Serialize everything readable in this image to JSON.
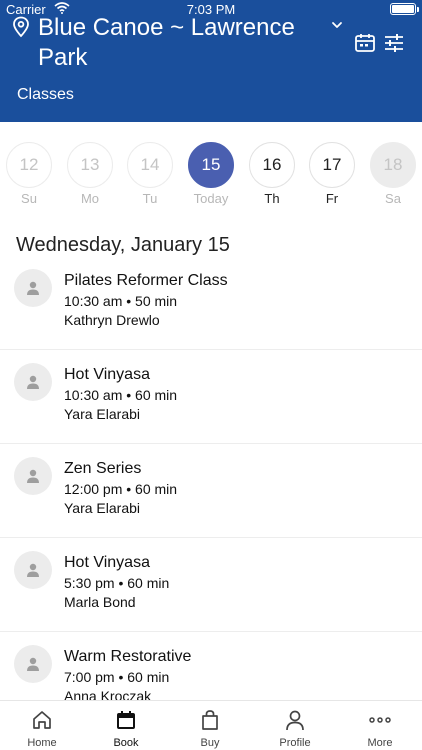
{
  "status_bar": {
    "carrier": "Carrier",
    "time": "7:03 PM"
  },
  "header": {
    "location": "Blue Canoe ~ Lawrence Park",
    "section": "Classes"
  },
  "date_strip": [
    {
      "num": "12",
      "label": "Su",
      "state": "past"
    },
    {
      "num": "13",
      "label": "Mo",
      "state": "past"
    },
    {
      "num": "14",
      "label": "Tu",
      "state": "past"
    },
    {
      "num": "15",
      "label": "Today",
      "state": "today"
    },
    {
      "num": "16",
      "label": "Th",
      "state": "future"
    },
    {
      "num": "17",
      "label": "Fr",
      "state": "future"
    },
    {
      "num": "18",
      "label": "Sa",
      "state": "disabled"
    }
  ],
  "date_heading": "Wednesday, January 15",
  "classes": [
    {
      "name": "Pilates Reformer Class",
      "time": "10:30 am • 50 min",
      "instructor": "Kathryn Drewlo"
    },
    {
      "name": "Hot Vinyasa",
      "time": "10:30 am • 60 min",
      "instructor": "Yara Elarabi"
    },
    {
      "name": "Zen Series",
      "time": "12:00 pm • 60 min",
      "instructor": "Yara Elarabi"
    },
    {
      "name": "Hot Vinyasa",
      "time": "5:30 pm • 60 min",
      "instructor": "Marla Bond"
    },
    {
      "name": "Warm Restorative",
      "time": "7:00 pm • 60 min",
      "instructor": "Anna Kroczak"
    }
  ],
  "tabs": [
    {
      "label": "Home",
      "icon": "home-icon"
    },
    {
      "label": "Book",
      "icon": "calendar-icon",
      "active": true
    },
    {
      "label": "Buy",
      "icon": "bag-icon"
    },
    {
      "label": "Profile",
      "icon": "person-icon"
    },
    {
      "label": "More",
      "icon": "more-icon"
    }
  ],
  "colors": {
    "header_bg": "#1a4f9c",
    "today_circle": "#4a5fb0"
  }
}
